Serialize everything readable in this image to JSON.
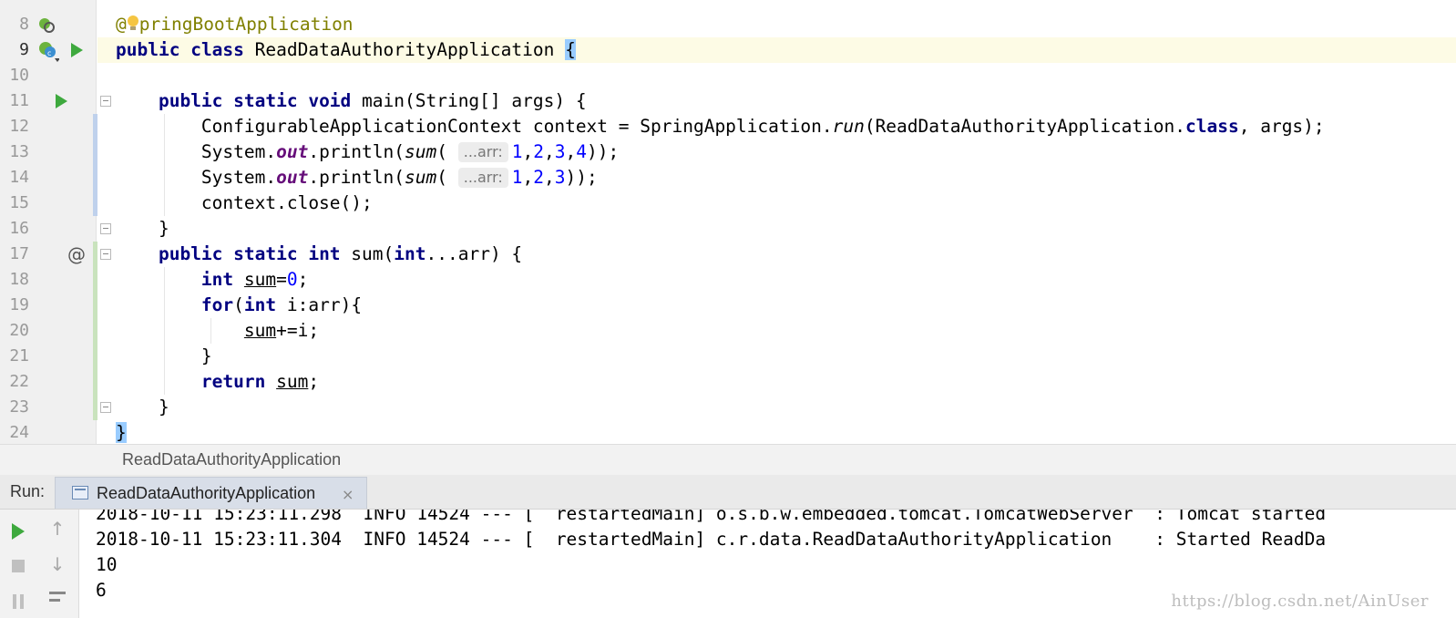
{
  "editor": {
    "line_numbers": [
      "8",
      "9",
      "10",
      "11",
      "12",
      "13",
      "14",
      "15",
      "16",
      "17",
      "18",
      "19",
      "20",
      "21",
      "22",
      "23",
      "24"
    ],
    "current_line": "9",
    "code": {
      "l8_rest": "pringBootApplication",
      "l9_public": "public",
      "l9_class": "class",
      "l9_name": " ReadDataAuthorityApplication ",
      "l9_brace": "{",
      "l11_kw": "public static void",
      "l11_rest": " main(String[] args) {",
      "l12_a": "ConfigurableApplicationContext context = SpringApplication.",
      "l12_run": "run",
      "l12_b": "(ReadDataAuthorityApplication.",
      "l12_class": "class",
      "l12_c": ", args);",
      "l13_a": "System.",
      "l13_out": "out",
      "l13_b": ".println(",
      "l13_sum": "sum",
      "l13_c": "( ",
      "l13_hint": "...arr:",
      "l13_n1": "1",
      "l13_n2": "2",
      "l13_n3": "3",
      "l13_n4": "4",
      "l13_end": "));",
      "l14_a": "System.",
      "l14_out": "out",
      "l14_b": ".println(",
      "l14_sum": "sum",
      "l14_c": "( ",
      "l14_hint": "...arr:",
      "l14_n1": "1",
      "l14_n2": "2",
      "l14_n3": "3",
      "l14_end": "));",
      "l15": "context.close();",
      "l16": "}",
      "l17_kw1": "public static int",
      "l17_a": " sum(",
      "l17_kw2": "int",
      "l17_b": "...arr) {",
      "l18_kw": "int",
      "l18_var": "sum",
      "l18_eq": "=",
      "l18_num": "0",
      "l18_end": ";",
      "l19_kw1": "for",
      "l19_a": "(",
      "l19_kw2": "int",
      "l19_b": " i:arr){",
      "l20_var": "sum",
      "l20_rest": "+=i;",
      "l21": "}",
      "l22_kw": "return",
      "l22_var": "sum",
      "l22_end": ";",
      "l23": "}",
      "l24": "}"
    }
  },
  "breadcrumb": "ReadDataAuthorityApplication",
  "run_panel": {
    "label": "Run:",
    "tab_label": "ReadDataAuthorityApplication",
    "tab_close": "×"
  },
  "console": {
    "lines": [
      "2018-10-11 15:23:11.298  INFO 14524 --- [  restartedMain] o.s.b.w.embedded.tomcat.TomcatWebServer  : Tomcat started",
      "2018-10-11 15:23:11.304  INFO 14524 --- [  restartedMain] c.r.data.ReadDataAuthorityApplication    : Started ReadDa",
      "10",
      "6"
    ]
  },
  "watermark": "https://blog.csdn.net/AinUser",
  "colors": {
    "keyword": "#000080",
    "annotation": "#808000",
    "number": "#0000ff",
    "static_field": "#660e7a",
    "run_green": "#3ea93e",
    "current_line_bg": "#fdfbe5"
  },
  "icons": [
    "spring-bean-icon",
    "run-icon",
    "override-at-icon",
    "fold-marker-icon",
    "stop-icon",
    "pause-icon",
    "scroll-up-icon",
    "scroll-down-icon",
    "soft-wrap-icon",
    "console-tab-icon",
    "close-icon",
    "lightbulb-icon"
  ]
}
